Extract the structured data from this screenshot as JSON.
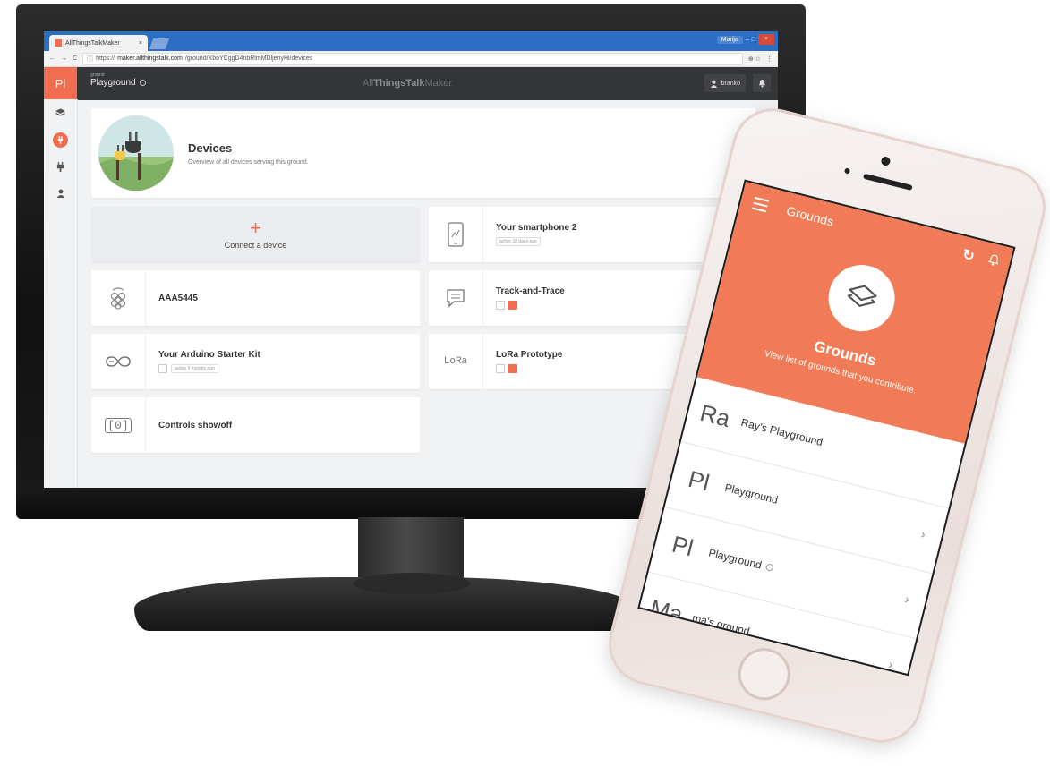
{
  "browser": {
    "tab_title": "AllThingsTalkMaker",
    "tab_close": "×",
    "window_user": "Marija",
    "window_min": "–",
    "window_max": "□",
    "window_close": "×",
    "url_prefix": "https://",
    "url_domain": "maker.allthingstalk.com",
    "url_path": "/ground/XboYCggD4nbRlmMDljeriyHi/devices",
    "nav_back": "←",
    "nav_forward": "→",
    "nav_reload": "C",
    "ext_icons": "⊕ ☆",
    "menu": "⋮"
  },
  "app": {
    "logo": "Pl",
    "ground_label": "ground",
    "ground_name": "Playground",
    "brand_all": "All",
    "brand_things": "ThingsTalk",
    "brand_maker": "Maker",
    "user": "branko"
  },
  "devices_page": {
    "title": "Devices",
    "subtitle": "Overview of all devices serving this ground."
  },
  "cards": [
    {
      "title": "Connect a device",
      "plus": "+"
    },
    {
      "title": "Your smartphone 2",
      "badge": "active 18 days ago"
    },
    {
      "title": "AAA5445"
    },
    {
      "title": "Track-and-Trace"
    },
    {
      "title": "Your Arduino Starter Kit",
      "badge": "active 3 months ago"
    },
    {
      "title": "LoRa Prototype",
      "icon_text": "LoRa"
    },
    {
      "title": "Controls showoff",
      "icon_text": "[0]"
    }
  ],
  "phone": {
    "header_title": "Grounds",
    "hero_title": "Grounds",
    "hero_subtitle": "View list of grounds that you contribute.",
    "grounds": [
      {
        "abbr": "Ra",
        "name": "Ray's Playground"
      },
      {
        "abbr": "Pl",
        "name": "Playground"
      },
      {
        "abbr": "Pl",
        "name": "Playground"
      },
      {
        "abbr": "Ma",
        "name": "ma's ground"
      }
    ],
    "chevron": "›"
  }
}
